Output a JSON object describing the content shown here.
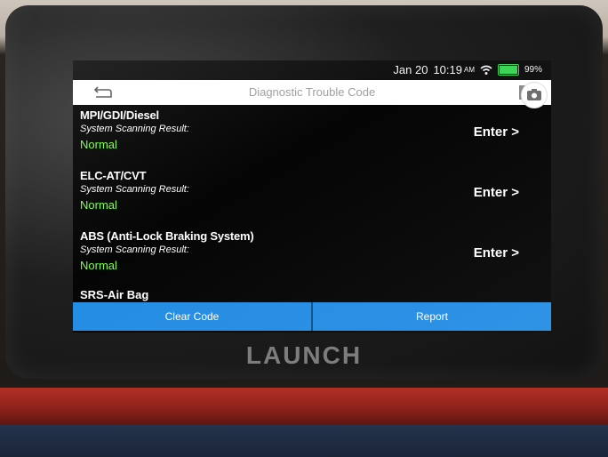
{
  "status_bar": {
    "date": "Jan 20",
    "time": "10:19",
    "ampm": "AM",
    "battery": "99%",
    "battery_color": "#39d353"
  },
  "title_bar": {
    "title": "Diagnostic Trouble Code",
    "back_icon": "back-arrow-icon",
    "camera_icon": "camera-icon"
  },
  "systems": [
    {
      "name": "MPI/GDI/Diesel",
      "scan_label": "System Scanning Result:",
      "status": "Normal",
      "action": "Enter >"
    },
    {
      "name": "ELC-AT/CVT",
      "scan_label": "System Scanning Result:",
      "status": "Normal",
      "action": "Enter >"
    },
    {
      "name": "ABS (Anti-Lock Braking System)",
      "scan_label": "System Scanning Result:",
      "status": "Normal",
      "action": "Enter >"
    }
  ],
  "partial_system": {
    "name": "SRS-Air Bag"
  },
  "bottom_bar": {
    "clear_code": "Clear Code",
    "report": "Report",
    "button_color": "#1f8ae3"
  },
  "device": {
    "brand": "LAUNCH"
  },
  "colors": {
    "status_normal": "#7dff49"
  }
}
